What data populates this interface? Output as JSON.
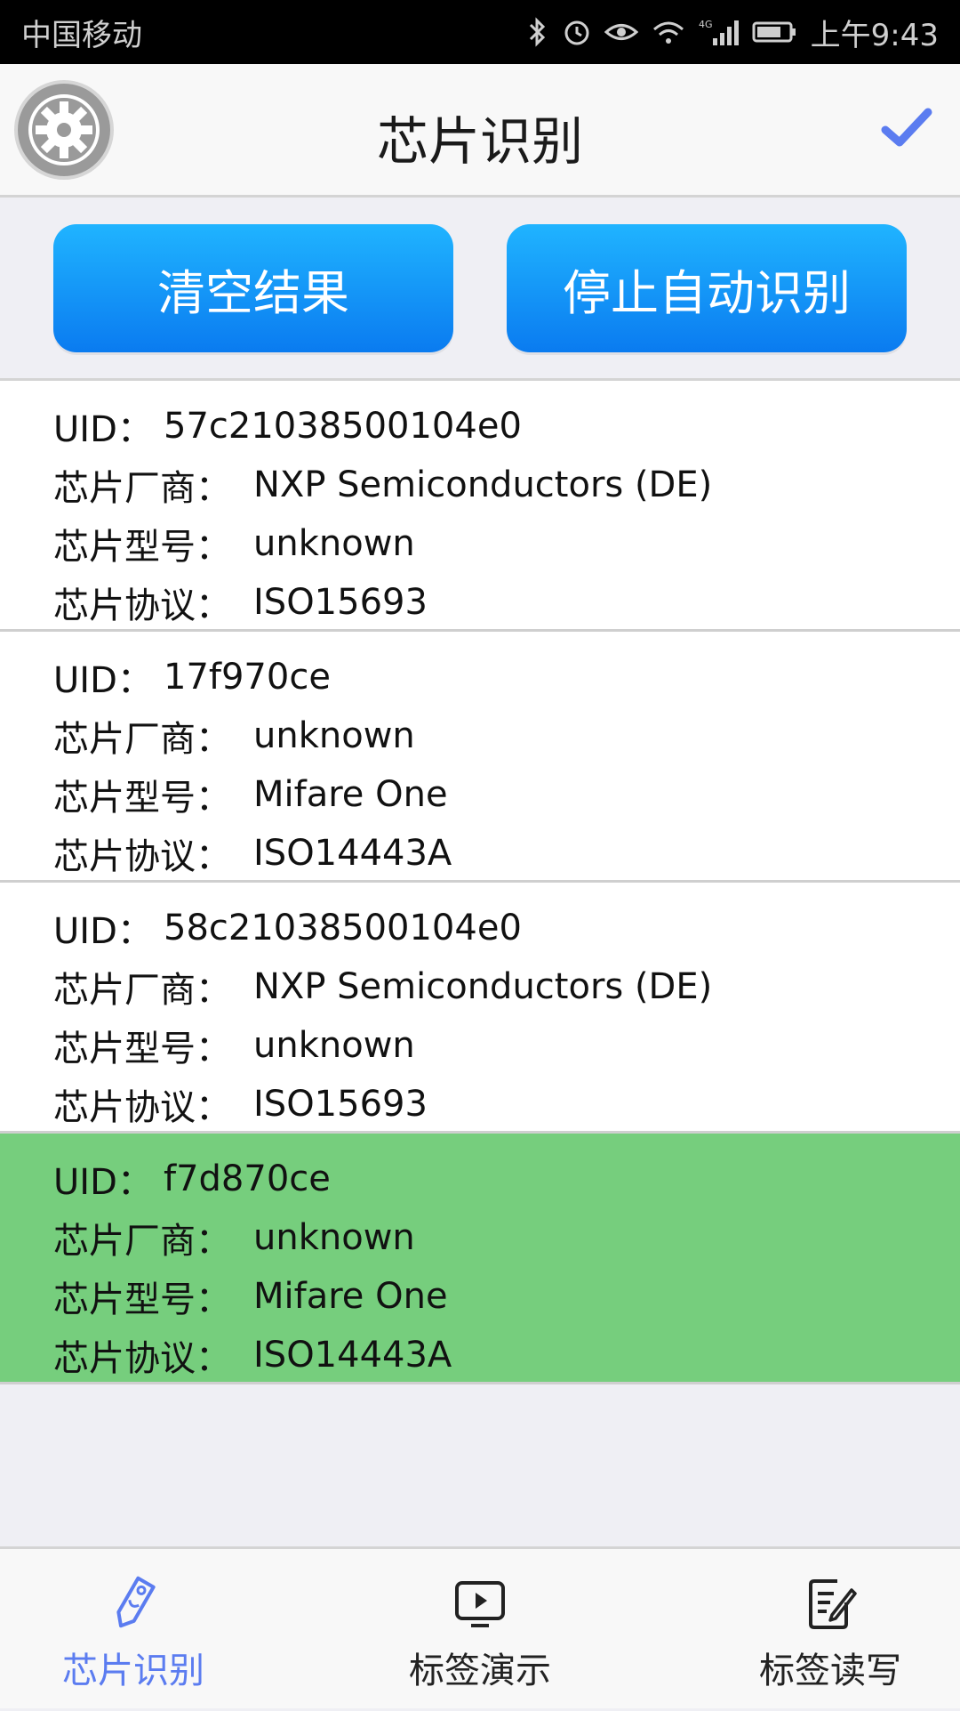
{
  "status": {
    "carrier": "中国移动",
    "time": "上午9:43",
    "network": "4G"
  },
  "header": {
    "title": "芯片识别"
  },
  "buttons": {
    "clear": "清空结果",
    "stop": "停止自动识别"
  },
  "labels": {
    "uid": "UID：",
    "vendor": "芯片厂商：",
    "model": "芯片型号：",
    "protocol": "芯片协议："
  },
  "cards": [
    {
      "uid": "57c21038500104e0",
      "vendor": "NXP Semiconductors (DE)",
      "model": "unknown",
      "protocol": "ISO15693"
    },
    {
      "uid": "17f970ce",
      "vendor": "unknown",
      "model": "Mifare One",
      "protocol": "ISO14443A"
    },
    {
      "uid": "58c21038500104e0",
      "vendor": "NXP Semiconductors (DE)",
      "model": "unknown",
      "protocol": "ISO15693"
    },
    {
      "uid": "f7d870ce",
      "vendor": "unknown",
      "model": "Mifare One",
      "protocol": "ISO14443A",
      "highlighted": true
    }
  ],
  "nav": [
    {
      "label": "芯片识别",
      "icon": "tag-icon",
      "active": true
    },
    {
      "label": "标签演示",
      "icon": "play-screen-icon"
    },
    {
      "label": "标签读写",
      "icon": "edit-document-icon"
    }
  ],
  "colors": {
    "accent": "#5b7cf0",
    "button": "#0a7bf0",
    "highlight": "#76ce7d"
  }
}
